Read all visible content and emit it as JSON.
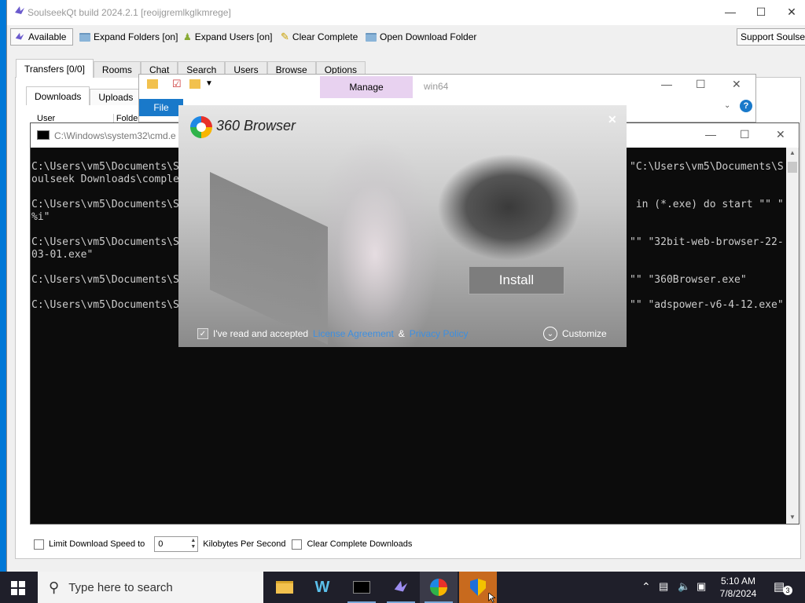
{
  "soulseek": {
    "title": "SoulseekQt build 2024.2.1 [reoijgremlkglkmrege]",
    "status_button": "Available",
    "toolbar": {
      "expand_folders": "Expand Folders [on]",
      "expand_users": "Expand Users [on]",
      "clear_complete": "Clear Complete",
      "open_download_folder": "Open Download Folder",
      "support": "Support Soulseek"
    },
    "tabs": [
      "Transfers [0/0]",
      "Rooms",
      "Chat",
      "Search",
      "Users",
      "Browse",
      "Options"
    ],
    "subtabs": [
      "Downloads",
      "Uploads"
    ],
    "columns": [
      "User",
      "Folder"
    ],
    "bottom": {
      "limit_label": "Limit Download Speed to",
      "speed_value": "0",
      "unit_label": "Kilobytes Per Second",
      "clear_label": "Clear Complete Downloads"
    }
  },
  "explorer": {
    "manage": "Manage",
    "path": "win64",
    "file_tab": "File"
  },
  "cmd": {
    "title": "C:\\Windows\\system32\\cmd.e",
    "lines_left": [
      "C:\\Users\\vm5\\Documents\\S",
      "oulseek Downloads\\comple",
      "C:\\Users\\vm5\\Documents\\S",
      "%i\"",
      "C:\\Users\\vm5\\Documents\\S",
      "03-01.exe\"",
      "C:\\Users\\vm5\\Documents\\S",
      "C:\\Users\\vm5\\Documents\\S"
    ],
    "lines_right": [
      "\"C:\\Users\\vm5\\Documents\\S",
      " in (*.exe) do start \"\" \"",
      "\"\" \"32bit-web-browser-22-",
      "\"\" \"360Browser.exe\"",
      "\"\" \"adspower-v6-4-12.exe\""
    ]
  },
  "installer": {
    "brand": "360 Browser",
    "install_label": "Install",
    "agree_text": "I've read and accepted",
    "license_link": "License Agreement",
    "amp": "&",
    "privacy_link": "Privacy Policy",
    "customize": "Customize"
  },
  "taskbar": {
    "search_placeholder": "Type here to search",
    "time": "5:10 AM",
    "date": "7/8/2024",
    "notification_count": "3"
  }
}
